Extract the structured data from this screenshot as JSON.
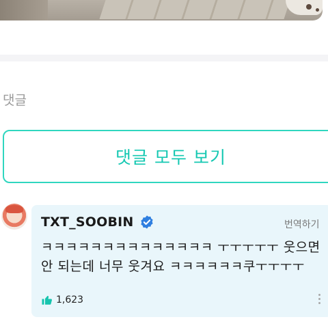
{
  "post": {
    "photo_icon": "photo-image"
  },
  "comments_section": {
    "label": "댓글",
    "view_all_label": "댓글 모두 보기"
  },
  "comment": {
    "author": "TXT_SOOBIN",
    "verified_icon": "verified-check-icon",
    "translate_label": "번역하기",
    "text_line1": "ㅋㅋㅋㅋㅋㅋㅋㅋㅋㅋㅋㅋㅋㅋ ㅜㅜㅜㅜㅜ 웃으면",
    "text_line2": "안 되는데 너무 웃겨요 ㅋㅋㅋㅋㅋㅋ쿠ㅜㅜㅜㅜ",
    "like_icon": "thumbs-up-icon",
    "like_count": "1,623",
    "more_icon": "more-vertical-icon"
  },
  "colors": {
    "accent": "#15c8b2",
    "card_bg": "#e9f6fb",
    "verified": "#2f7fe0"
  }
}
